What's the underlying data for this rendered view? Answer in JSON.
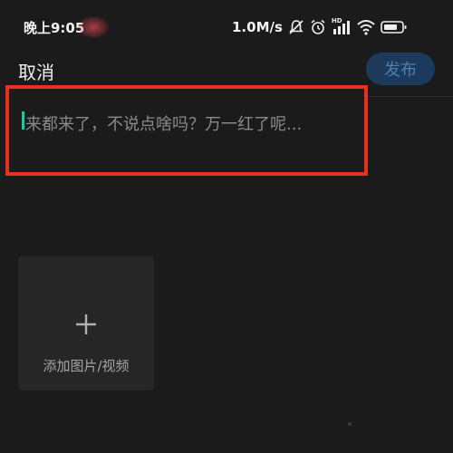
{
  "status_bar": {
    "time": "晚上9:05",
    "network_speed": "1.0M/s",
    "icons": [
      "mute-bell-icon",
      "alarm-icon",
      "hd-signal-icon",
      "wifi-icon",
      "battery-icon"
    ],
    "signal_label": "HD"
  },
  "header": {
    "cancel_label": "取消",
    "publish_label": "发布"
  },
  "editor": {
    "value": "",
    "placeholder": "来都来了，不说点啥吗？万一红了呢..."
  },
  "media": {
    "add_label": "添加图片/视频",
    "icon": "plus-icon"
  },
  "colors": {
    "background": "#1b1b1b",
    "highlight_border": "#e8301f",
    "caret": "#2fbf9b",
    "publish_bg": "#1c3a5c",
    "publish_text": "#4f7fae"
  }
}
